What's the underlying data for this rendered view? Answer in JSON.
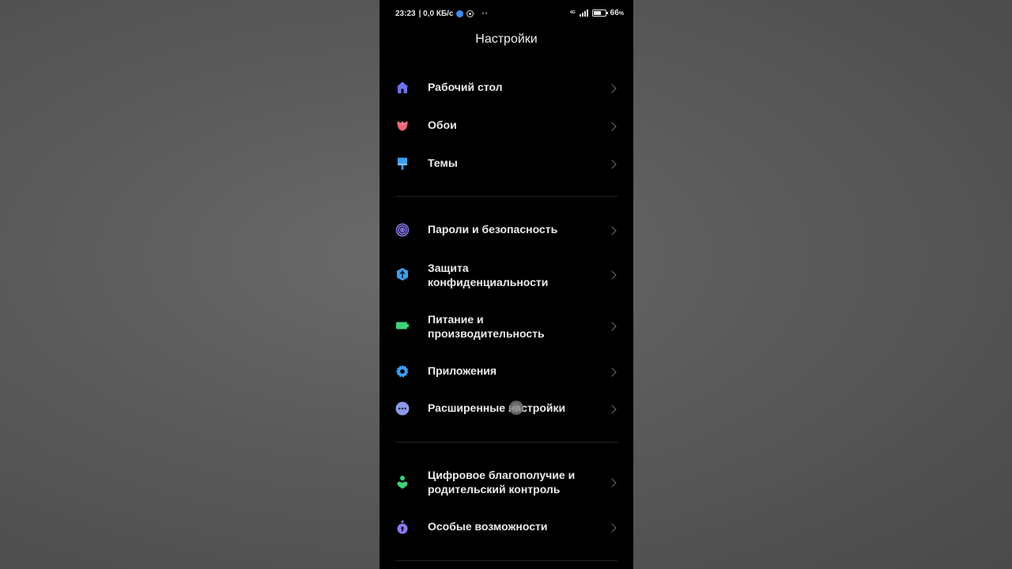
{
  "status_bar": {
    "time": "23:23",
    "speed": "| 0,0 КБ/с",
    "more": "··",
    "battery_level": "66",
    "battery_unit": "%",
    "network": "4G"
  },
  "header": {
    "title": "Настройки"
  },
  "sections": [
    {
      "items": [
        {
          "label": "Рабочий стол",
          "icon": "home-icon",
          "color": "#6f72f0"
        },
        {
          "label": "Обои",
          "icon": "tulip-icon",
          "color": "#f0677a"
        },
        {
          "label": "Темы",
          "icon": "paintbrush-icon",
          "color": "#3c9ef5"
        }
      ]
    },
    {
      "items": [
        {
          "label": "Пароли и безопасность",
          "icon": "fingerprint-icon",
          "color": "#8a7cf0"
        },
        {
          "label": "Защита",
          "label2": "конфиденциальности",
          "icon": "privacy-shield-icon",
          "color": "#3aa0f2"
        },
        {
          "label": "Питание и",
          "label2": "производительность",
          "icon": "battery-icon",
          "color": "#3ed17b"
        },
        {
          "label": "Приложения",
          "icon": "gear-icon",
          "color": "#3c9ef5"
        },
        {
          "label": "Расширенные настройки",
          "icon": "more-dots-icon",
          "color": "#8e9ae8"
        }
      ]
    },
    {
      "items": [
        {
          "label": "Цифровое благополучие и",
          "label2": "родительский контроль",
          "icon": "wellbeing-icon",
          "color": "#3ed17b"
        },
        {
          "label": "Особые возможности",
          "icon": "accessibility-icon",
          "color": "#8a7cf0"
        }
      ]
    }
  ]
}
